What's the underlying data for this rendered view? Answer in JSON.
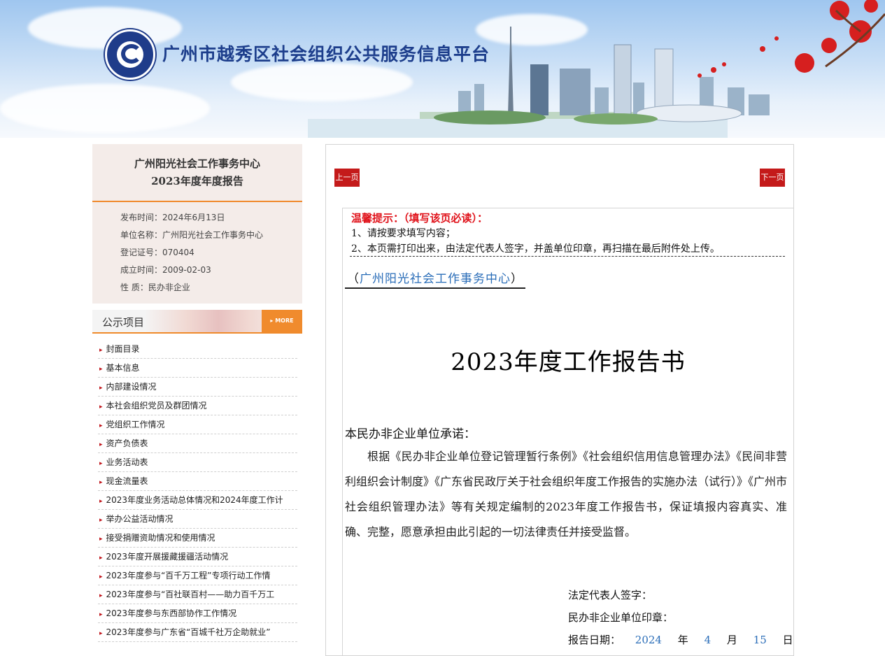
{
  "banner": {
    "title": "广州市越秀区社会组织公共服务信息平台"
  },
  "info": {
    "org_name": "广州阳光社会工作事务中心",
    "report_name": "2023年度年度报告",
    "rows": [
      "发布时间：2024年6月13日",
      "单位名称：广州阳光社会工作事务中心",
      "登记证号：070404",
      "成立时间：2009-02-03",
      "性  质：民办非企业"
    ]
  },
  "publicity": {
    "label": "公示项目",
    "more": "MORE",
    "items": [
      "封面目录",
      "基本信息",
      "内部建设情况",
      "本社会组织党员及群团情况",
      "党组织工作情况",
      "资产负债表",
      "业务活动表",
      "现金流量表",
      "2023年度业务活动总体情况和2024年度工作计",
      "举办公益活动情况",
      "接受捐赠资助情况和使用情况",
      "2023年度开展援藏援疆活动情况",
      "2023年度参与“百千万工程”专项行动工作情",
      "2023年度参与“百社联百村——助力百千万工",
      "2023年度参与东西部协作工作情况",
      "2023年度参与广东省“百城千社万企助就业”"
    ]
  },
  "nav": {
    "prev": "上一页",
    "next": "下一页"
  },
  "notice": {
    "title": "温馨提示：（填写该页必读）：",
    "line1": "1、请按要求填写内容；",
    "line2": "2、本页需打印出来，由法定代表人签字，并盖单位印章，再扫描在最后附件处上传。"
  },
  "doc": {
    "open_paren": "（",
    "org": "广州阳光社会工作事务中心",
    "close_paren": "）",
    "title": "2023年度工作报告书",
    "pledge_heading": "本民办非企业单位承诺：",
    "pledge_body": "根据《民办非企业单位登记管理暂行条例》《社会组织信用信息管理办法》《民间非营利组织会计制度》《广东省民政厅关于社会组织年度工作报告的实施办法（试行）》《广州市社会组织管理办法》等有关规定编制的2023年度工作报告书，保证填报内容真实、准确、完整，愿意承担由此引起的一切法律责任并接受监督。",
    "sign_rep": "法定代表人签字：",
    "sign_seal": "民办非企业单位印章：",
    "date_label": "报告日期：",
    "year": "2024",
    "year_unit": "年",
    "month": "4",
    "month_unit": "月",
    "day": "15",
    "day_unit": "日"
  },
  "colors": {
    "accent_orange": "#f08b2d",
    "nav_red": "#c41a1a",
    "title_blue": "#1d3e8c",
    "notice_red": "#e0131b",
    "link_blue": "#2a6db8"
  }
}
